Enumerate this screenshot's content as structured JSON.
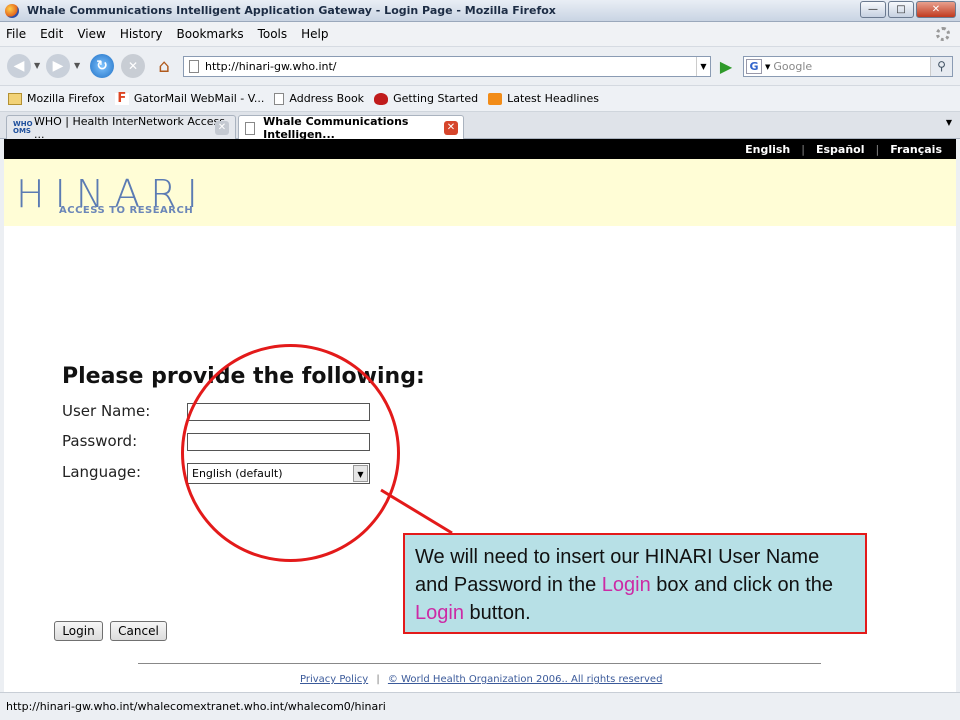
{
  "window": {
    "title": "Whale Communications Intelligent Application Gateway - Login Page - Mozilla Firefox"
  },
  "menu": [
    "File",
    "Edit",
    "View",
    "History",
    "Bookmarks",
    "Tools",
    "Help"
  ],
  "nav": {
    "url": "http://hinari-gw.who.int/",
    "search_placeholder": "Google"
  },
  "bookmarks": [
    "Mozilla Firefox",
    "GatorMail WebMail - V...",
    "Address Book",
    "Getting Started",
    "Latest Headlines"
  ],
  "tabs": [
    {
      "label": "WHO | Health InterNetwork Access ...",
      "favicon": "WHO OMS"
    },
    {
      "label": "Whale Communications Intelligen..."
    }
  ],
  "languages": [
    "English",
    "Español",
    "Français"
  ],
  "logo": {
    "main": "HINARI",
    "sub": "ACCESS TO RESEARCH"
  },
  "form": {
    "heading": "Please provide the following:",
    "username_label": "User Name:",
    "password_label": "Password:",
    "language_label": "Language:",
    "language_value": "English (default)",
    "login_button": "Login",
    "cancel_button": "Cancel"
  },
  "callout": {
    "part1": "We will need to insert our HINARI User Name and Password in the ",
    "hl1": "Login",
    "part2": " box and click on the ",
    "hl2": "Login",
    "part3": " button."
  },
  "footer": {
    "privacy": "Privacy Policy",
    "separator": "|",
    "copyright": "© World Health Organization 2006.. All rights reserved"
  },
  "status": "http://hinari-gw.who.int/whalecomextranet.who.int/whalecom0/hinari",
  "colors": {
    "callout_border": "#e31a1a",
    "callout_bg": "#b7e0e6",
    "highlight": "#cc2aa5",
    "banner": "#fffdd6"
  }
}
